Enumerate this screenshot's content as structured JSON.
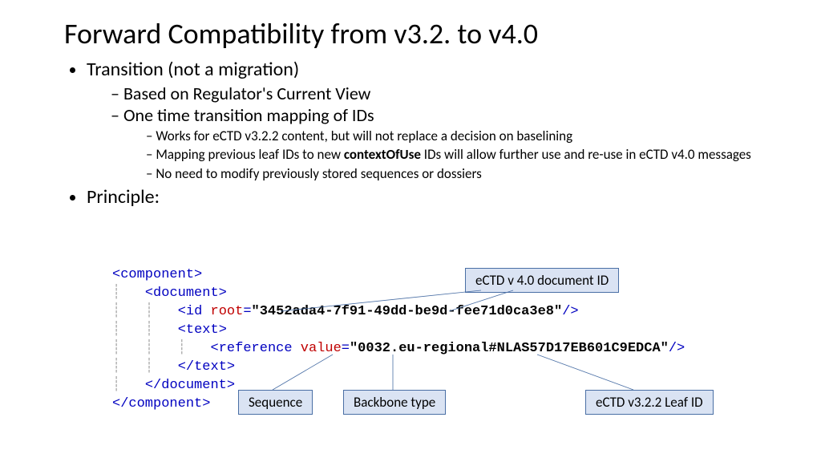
{
  "title": "Forward Compatibility from v3.2. to v4.0",
  "bullets": {
    "b1": "Transition (not a migration)",
    "b1_1": "Based on Regulator's Current View",
    "b1_2": "One time transition mapping of IDs",
    "b1_2_1": "Works for eCTD v3.2.2 content, but will not replace a decision on baselining",
    "b1_2_2a": "Mapping previous leaf IDs to new ",
    "b1_2_2b": "contextOfUse",
    "b1_2_2c": " IDs will allow further use and re-use in eCTD v4.0 messages",
    "b1_2_3": "No need to modify previously stored sequences or dossiers",
    "b2": "Principle:"
  },
  "xml": {
    "component_open": "<component>",
    "document_open": "<document>",
    "id_tag": "<id",
    "id_attr": " root",
    "id_eq": "=",
    "id_val": "\"3452ada4-7f91-49dd-be9d-fee71d0ca3e8\"",
    "id_close": "/>",
    "text_open": "<text>",
    "ref_tag": "<reference",
    "ref_attr": " value",
    "ref_eq": "=",
    "ref_val_a": "\"0032.",
    "ref_val_b": "eu-regional",
    "ref_val_c": "#NLAS57D17EB601C9EDCA\"",
    "ref_close": "/>",
    "text_close": "</text>",
    "document_close": "</document>",
    "component_close": "</component>"
  },
  "callouts": {
    "doc_id": "eCTD v 4.0 document ID",
    "sequence": "Sequence",
    "backbone": "Backbone type",
    "leaf_id": "eCTD v3.2.2 Leaf ID"
  }
}
